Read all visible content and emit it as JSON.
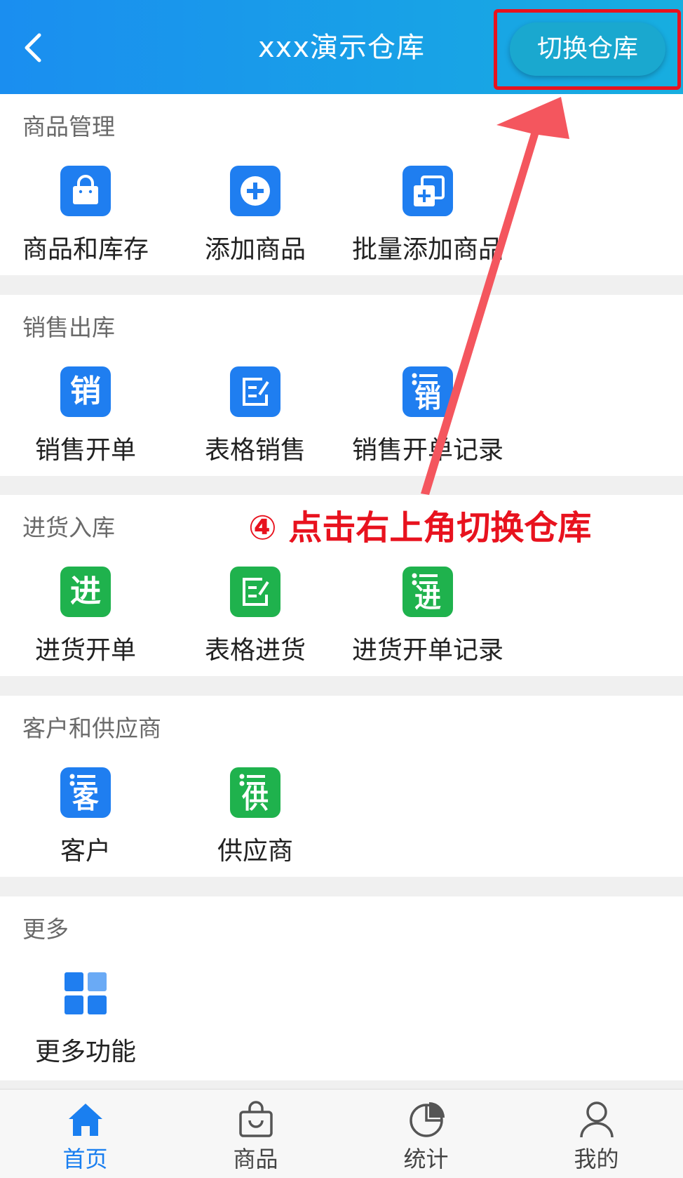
{
  "header": {
    "title": "xxx演示仓库",
    "switch_label": "切换仓库"
  },
  "annotation": "④ 点击右上角切换仓库",
  "sections": [
    {
      "title": "商品管理",
      "items": [
        {
          "label": "商品和库存",
          "icon": "shopping-bag-icon"
        },
        {
          "label": "添加商品",
          "icon": "add-circle-icon"
        },
        {
          "label": "批量添加商品",
          "icon": "batch-add-icon"
        }
      ]
    },
    {
      "title": "销售出库",
      "items": [
        {
          "label": "销售开单",
          "glyph": "销"
        },
        {
          "label": "表格销售",
          "icon": "edit-sheet-icon"
        },
        {
          "label": "销售开单记录",
          "glyph": "销"
        }
      ]
    },
    {
      "title": "进货入库",
      "items": [
        {
          "label": "进货开单",
          "glyph": "进"
        },
        {
          "label": "表格进货",
          "icon": "edit-sheet-icon"
        },
        {
          "label": "进货开单记录",
          "glyph": "进"
        }
      ]
    },
    {
      "title": "客户和供应商",
      "items": [
        {
          "label": "客户",
          "glyph": "客"
        },
        {
          "label": "供应商",
          "glyph": "供"
        }
      ]
    },
    {
      "title": "更多",
      "items": [
        {
          "label": "更多功能",
          "icon": "grid-icon"
        }
      ]
    }
  ],
  "tabs": [
    {
      "label": "首页",
      "icon": "home-icon",
      "active": true
    },
    {
      "label": "商品",
      "icon": "bag-icon",
      "active": false
    },
    {
      "label": "统计",
      "icon": "pie-chart-icon",
      "active": false
    },
    {
      "label": "我的",
      "icon": "user-icon",
      "active": false
    }
  ],
  "colors": {
    "accent_blue": "#1f7ef0",
    "accent_green": "#1fb24d",
    "annotation_red": "#e8121e"
  }
}
